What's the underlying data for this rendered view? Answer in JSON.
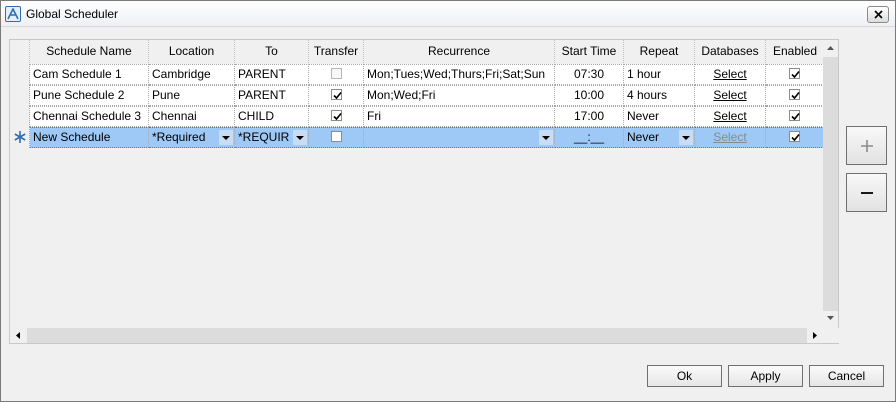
{
  "window": {
    "title": "Global Scheduler"
  },
  "grid": {
    "columns": [
      "Schedule Name",
      "Location",
      "To",
      "Transfer",
      "Recurrence",
      "Start Time",
      "Repeat",
      "Databases",
      "Enabled"
    ],
    "rows": [
      {
        "name": "Cam Schedule 1",
        "location": "Cambridge",
        "to": "PARENT",
        "transfer": false,
        "recurrence": "Mon;Tues;Wed;Thurs;Fri;Sat;Sun",
        "start": "07:30",
        "repeat": "1 hour",
        "databases": "Select",
        "enabled": true
      },
      {
        "name": "Pune Schedule 2",
        "location": "Pune",
        "to": "PARENT",
        "transfer": true,
        "recurrence": "Mon;Wed;Fri",
        "start": "10:00",
        "repeat": "4 hours",
        "databases": "Select",
        "enabled": true
      },
      {
        "name": "Chennai Schedule 3",
        "location": "Chennai",
        "to": "CHILD",
        "transfer": true,
        "recurrence": "Fri",
        "start": "17:00",
        "repeat": "Never",
        "databases": "Select",
        "enabled": true
      }
    ],
    "new_row": {
      "name": "New Schedule",
      "location": "*Required",
      "to": "*REQUIR",
      "transfer": false,
      "recurrence": "",
      "start": "__:__",
      "repeat": "Never",
      "databases": "Select",
      "enabled": true
    }
  },
  "buttons": {
    "ok": "Ok",
    "apply": "Apply",
    "cancel": "Cancel"
  },
  "colors": {
    "selected_row": "#9ec8f5",
    "accent": "#2f6db3"
  }
}
